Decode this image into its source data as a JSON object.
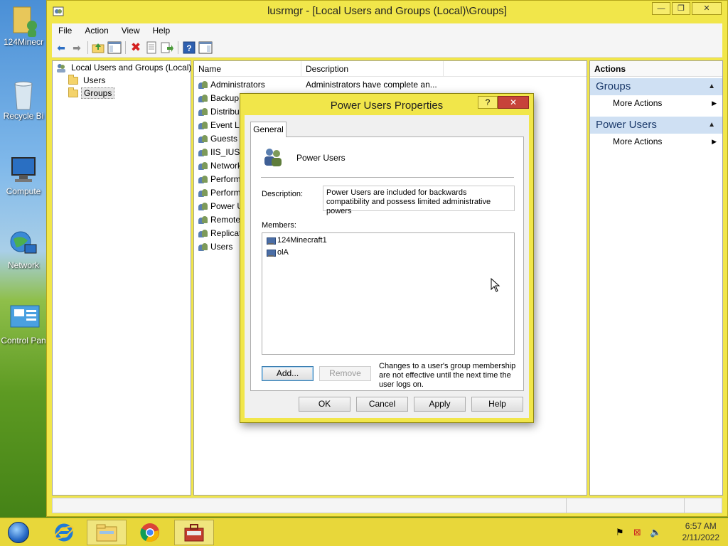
{
  "desktop": {
    "icons": [
      {
        "label": "124Minecr",
        "icon": "user-folder-icon"
      },
      {
        "label": "Recycle Bi",
        "icon": "recycle-bin-icon"
      },
      {
        "label": "Compute",
        "icon": "computer-icon"
      },
      {
        "label": "Network",
        "icon": "network-icon"
      },
      {
        "label": "Control Pan",
        "icon": "control-panel-icon"
      }
    ]
  },
  "window": {
    "title": "lusrmgr - [Local Users and Groups (Local)\\Groups]",
    "caption": {
      "minimize": "—",
      "restore": "❐",
      "close": "✕"
    },
    "menu": [
      "File",
      "Action",
      "View",
      "Help"
    ]
  },
  "tree": {
    "root": "Local Users and Groups (Local)",
    "items": [
      "Users",
      "Groups"
    ],
    "selected": "Groups"
  },
  "list": {
    "columns": [
      "Name",
      "Description"
    ],
    "rows": [
      {
        "name": "Administrators",
        "desc": "Administrators have complete an..."
      },
      {
        "name": "Backup",
        "desc": ""
      },
      {
        "name": "Distribu",
        "desc": ""
      },
      {
        "name": "Event Lo",
        "desc": ""
      },
      {
        "name": "Guests",
        "desc": ""
      },
      {
        "name": "IIS_IUSR",
        "desc": ""
      },
      {
        "name": "Network",
        "desc": ""
      },
      {
        "name": "Perform",
        "desc": ""
      },
      {
        "name": "Perform",
        "desc": ""
      },
      {
        "name": "Power U",
        "desc": ""
      },
      {
        "name": "Remote",
        "desc": ""
      },
      {
        "name": "Replicat",
        "desc": ""
      },
      {
        "name": "Users",
        "desc": ""
      }
    ]
  },
  "actions": {
    "header": "Actions",
    "sections": [
      {
        "title": "Groups",
        "item": "More Actions"
      },
      {
        "title": "Power Users",
        "item": "More Actions"
      }
    ]
  },
  "dialog": {
    "title": "Power Users Properties",
    "help_btn": "?",
    "close_btn": "✕",
    "tab": "General",
    "group_name": "Power Users",
    "description_label": "Description:",
    "description": "Power Users are included for backwards compatibility and possess limited administrative powers",
    "members_label": "Members:",
    "members": [
      "124Minecraft1",
      "olA"
    ],
    "add_btn": "Add...",
    "remove_btn": "Remove",
    "note": "Changes to a user's group membership are not effective until the next time the user logs on.",
    "ok": "OK",
    "cancel": "Cancel",
    "apply": "Apply",
    "help": "Help"
  },
  "taskbar": {
    "apps": [
      "internet-explorer-icon",
      "file-explorer-icon",
      "chrome-icon",
      "computer-management-icon"
    ],
    "time": "6:57 AM",
    "date": "2/11/2022"
  }
}
